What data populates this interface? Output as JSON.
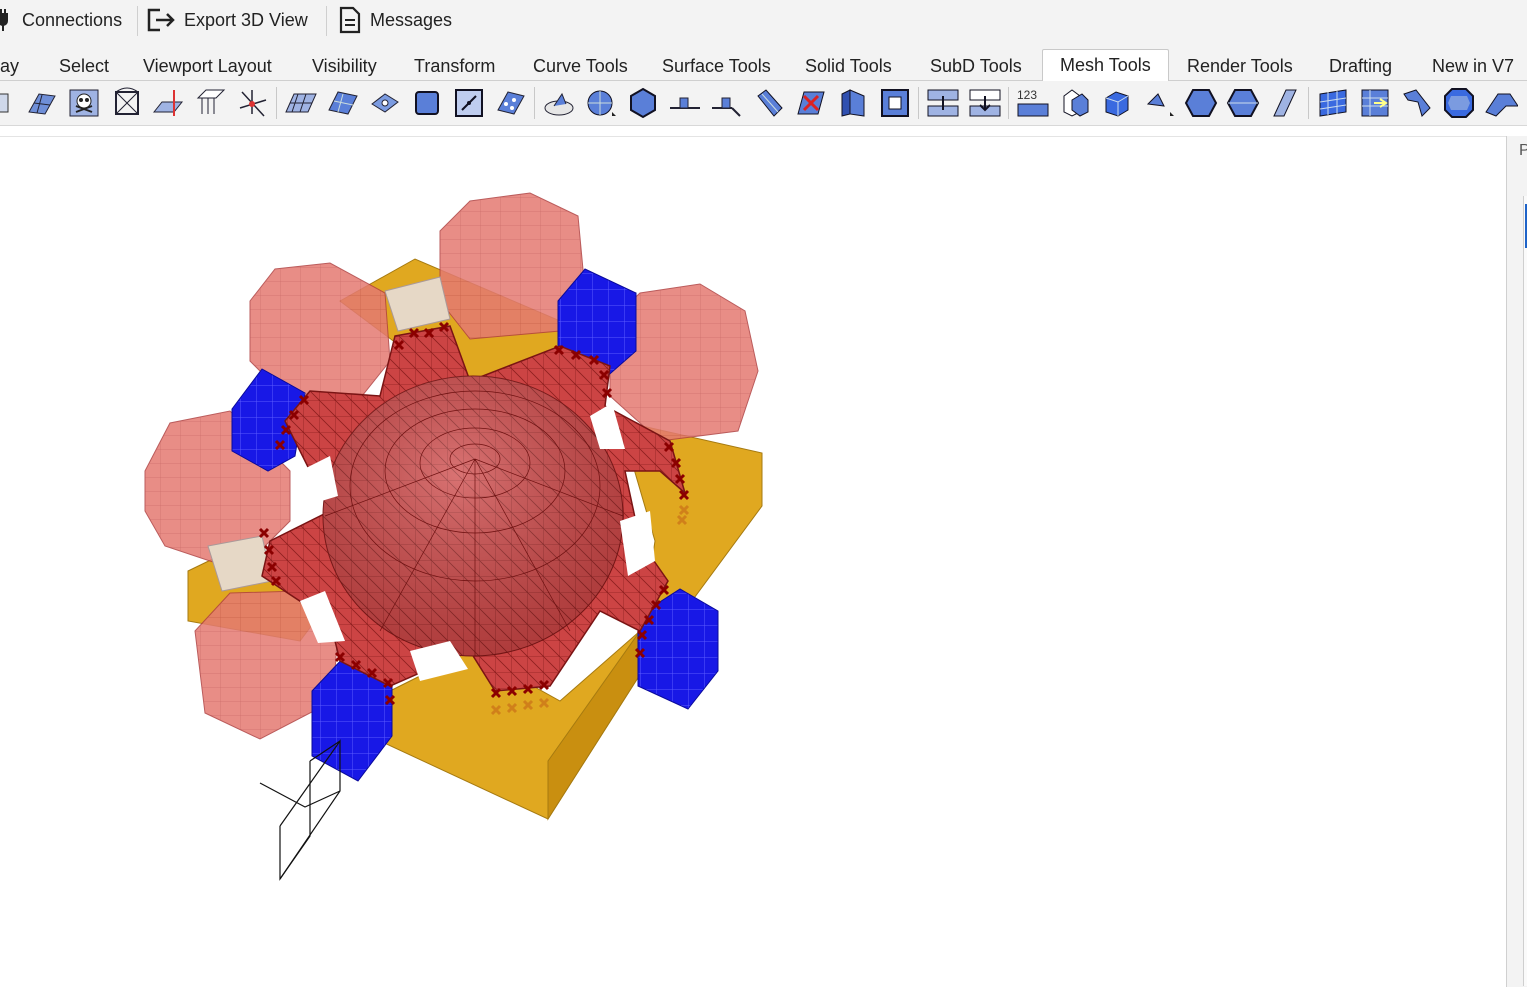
{
  "top_bar": {
    "connections_label": "Connections",
    "export_label": "Export 3D View",
    "messages_label": "Messages"
  },
  "tabs": [
    {
      "label": "ay"
    },
    {
      "label": "Select"
    },
    {
      "label": "Viewport Layout"
    },
    {
      "label": "Visibility"
    },
    {
      "label": "Transform"
    },
    {
      "label": "Curve Tools"
    },
    {
      "label": "Surface Tools"
    },
    {
      "label": "Solid Tools"
    },
    {
      "label": "SubD Tools"
    },
    {
      "label": "Mesh Tools",
      "active": true
    },
    {
      "label": "Render Tools"
    },
    {
      "label": "Drafting"
    },
    {
      "label": "New in V7"
    }
  ],
  "toolbar_icons": [
    "unknown-cut-icon",
    "mesh-patch-icon",
    "skull-mesh-icon",
    "mesh-box-icon",
    "mesh-plane-icon",
    "mesh-extrude-icon",
    "mesh-axis-icon",
    "mesh-grid-icon",
    "mesh-surface-icon",
    "mesh-smooth-icon",
    "mesh-frame-icon",
    "mesh-vertex-icon",
    "mesh-points-icon",
    "mesh-disk-icon",
    "mesh-sphere-icon",
    "mesh-polyhedron-icon",
    "mesh-offset-icon",
    "mesh-split-icon",
    "mesh-fold-icon",
    "mesh-cut-icon",
    "mesh-wall-icon",
    "mesh-hole-icon",
    "mesh-weld-icon",
    "mesh-unweld-icon",
    "mesh-number-icon",
    "mesh-flip-icon",
    "mesh-cube-icon",
    "mesh-triangle-icon",
    "mesh-hexagon-icon",
    "mesh-hexprism-icon",
    "mesh-slab-icon",
    "mesh-panel-icon",
    "mesh-unroll-icon",
    "mesh-bend-icon",
    "mesh-octagon-icon",
    "mesh-wedge-icon"
  ],
  "side_panel": {
    "label": "P"
  },
  "colors": {
    "mesh_red": "#cc3f3f",
    "octagon_red": "#e07070",
    "cube_blue": "#1515e0",
    "frame_gold": "#e0a820",
    "pink_block": "#e8c9c0",
    "marker_darkred": "#8b0000"
  }
}
